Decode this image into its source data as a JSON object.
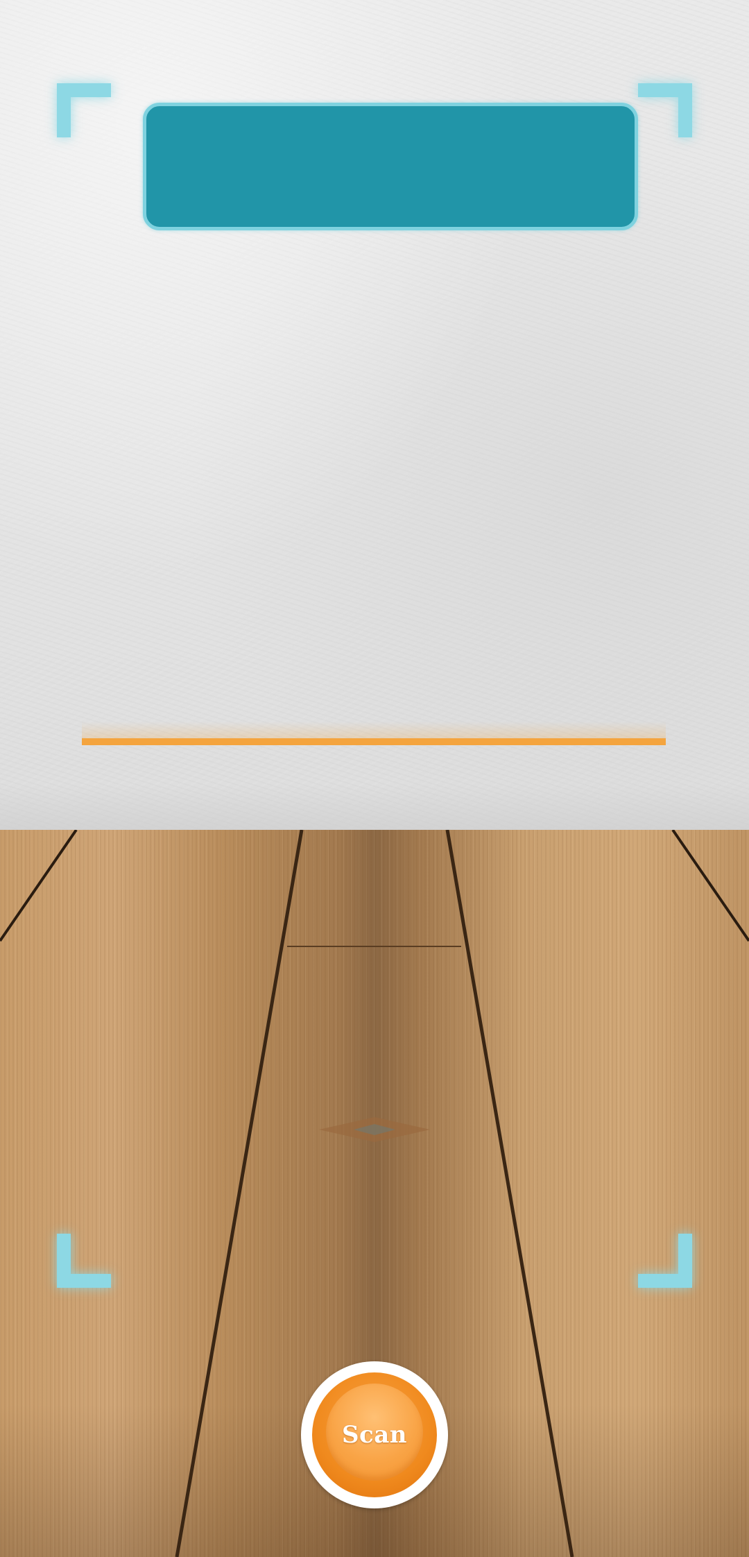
{
  "scan_button": {
    "label": "Scan"
  },
  "colors": {
    "banner_fill": "#2195a8",
    "banner_border": "#7fd2df",
    "frame_corner": "#8dd8e4",
    "scan_line": "#f4a43e",
    "button_orange": "#f08a1e"
  },
  "icons": {
    "frame_corners": "scan-frame-corner-icon"
  }
}
